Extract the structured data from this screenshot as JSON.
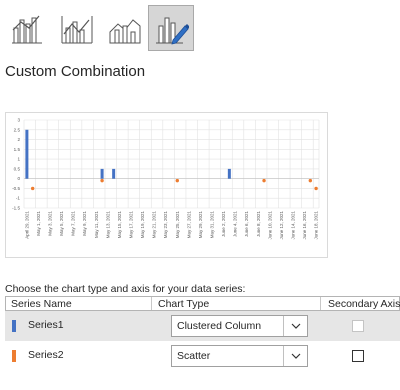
{
  "chart_types": [
    {
      "name": "clustered-column-line-icon",
      "selected": false
    },
    {
      "name": "column-line-secondary-axis-icon",
      "selected": false
    },
    {
      "name": "stacked-area-column-icon",
      "selected": false
    },
    {
      "name": "custom-combination-icon",
      "selected": true
    }
  ],
  "title": "Custom Combination",
  "preview": {
    "chart_data": {
      "type": "bar",
      "y_ticks": [
        "3",
        "2.5",
        "2",
        "1.5",
        "1",
        "0.5",
        "0",
        "-0.5",
        "-1",
        "-1.5"
      ],
      "ylim": [
        -1.5,
        3
      ],
      "grid": true,
      "x": [
        "April 29, 2021",
        "May 1, 2021",
        "May 3, 2021",
        "May 5, 2021",
        "May 7, 2021",
        "May 9, 2021",
        "May 11, 2021",
        "May 13, 2021",
        "May 15, 2021",
        "May 17, 2021",
        "May 19, 2021",
        "May 21, 2021",
        "May 23, 2021",
        "May 25, 2021",
        "May 27, 2021",
        "May 29, 2021",
        "May 31, 2021",
        "June 2, 2021",
        "June 4, 2021",
        "June 6, 2021",
        "June 8, 2021",
        "June 10, 2021",
        "June 12, 2021",
        "June 14, 2021",
        "June 16, 2021",
        "June 18, 2021"
      ],
      "series": [
        {
          "name": "Series1",
          "kind": "column",
          "color": "#4472c4",
          "points": [
            {
              "x": "April 29, 2021",
              "y": 2.5
            },
            {
              "x": "May 12, 2021",
              "y": 0.5
            },
            {
              "x": "May 14, 2021",
              "y": 0.5
            },
            {
              "x": "June 3, 2021",
              "y": 0.5
            }
          ]
        },
        {
          "name": "Series2",
          "kind": "scatter",
          "color": "#ed7d31",
          "points": [
            {
              "x": "April 30, 2021",
              "y": -0.5
            },
            {
              "x": "May 12, 2021",
              "y": -0.1
            },
            {
              "x": "May 25, 2021",
              "y": -0.1
            },
            {
              "x": "June 9, 2021",
              "y": -0.1
            },
            {
              "x": "June 17, 2021",
              "y": -0.1
            },
            {
              "x": "June 18, 2021",
              "y": -0.5
            }
          ]
        }
      ]
    }
  },
  "instruction": "Choose the chart type and axis for your data series:",
  "grid": {
    "headers": {
      "series_name": "Series Name",
      "chart_type": "Chart Type",
      "secondary_axis": "Secondary Axis"
    },
    "rows": [
      {
        "name": "Series1",
        "color": "#4472c4",
        "chart_type": "Clustered Column",
        "secondary": false,
        "secondary_enabled": false,
        "selected": true
      },
      {
        "name": "Series2",
        "color": "#ed7d31",
        "chart_type": "Scatter",
        "secondary": false,
        "secondary_enabled": true,
        "selected": false
      }
    ]
  }
}
